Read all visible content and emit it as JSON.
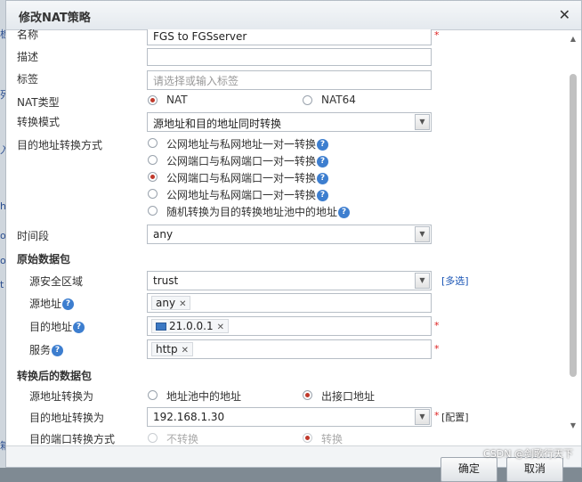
{
  "dialog": {
    "title": "修改NAT策略"
  },
  "bg": {
    "left_texts": [
      "板",
      "列",
      "入",
      "h",
      "o",
      "o",
      "t",
      "箱"
    ]
  },
  "form": {
    "name_label": "名称",
    "name_value": "FGS to FGSserver",
    "desc_label": "描述",
    "desc_value": "",
    "tag_label": "标签",
    "tag_placeholder": "请选择或输入标签",
    "nat_type_label": "NAT类型",
    "nat_type_options": [
      "NAT",
      "NAT64"
    ],
    "nat_type_selected": "NAT",
    "mode_label": "转换模式",
    "mode_value": "源地址和目的地址同时转换",
    "dst_mode_label": "目的地址转换方式",
    "dst_mode_options": [
      "公网地址与私网地址一对一转换",
      "公网端口与私网端口一对一转换",
      "公网端口与私网端口一对一转换",
      "公网地址与私网端口一对一转换",
      "随机转换为目的转换地址池中的地址"
    ],
    "dst_mode_selected_index": 2,
    "time_label": "时间段",
    "time_value": "any",
    "orig_section": "原始数据包",
    "src_zone_label": "源安全区域",
    "src_zone_value": "trust",
    "multi_select": "[多选]",
    "src_addr_label": "源地址",
    "src_addr_tag": "any",
    "dst_addr_label": "目的地址",
    "dst_addr_tag": "21.0.0.1",
    "service_label": "服务",
    "service_tag": "http",
    "trans_section": "转换后的数据包",
    "src_trans_label": "源地址转换为",
    "src_trans_options": [
      "地址池中的地址",
      "出接口地址"
    ],
    "src_trans_selected": "出接口地址",
    "dst_trans_label": "目的地址转换为",
    "dst_trans_value": "192.168.1.30",
    "config_link": "[配置]",
    "dst_port_label": "目的端口转换方式",
    "dst_port_options": [
      "不转换",
      "转换"
    ],
    "dst_port_selected": "转换",
    "help_mark": "?",
    "req_mark": "*",
    "x_mark": "✕",
    "arrow": "▼"
  },
  "footer": {
    "ok": "确定",
    "cancel": "取消"
  },
  "watermark": "CSDN @剑歌行天下",
  "icons": {
    "close": "close-icon",
    "help": "help-icon",
    "dropdown": "chevron-down-icon"
  },
  "colors": {
    "accent_radio": "#c0392b",
    "help": "#3d7ecf",
    "required": "#dd2222",
    "link": "#1a55b5"
  }
}
